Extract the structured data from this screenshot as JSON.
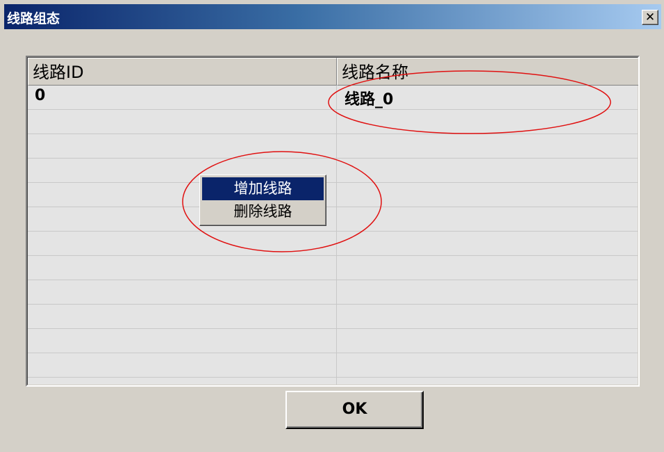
{
  "window": {
    "title": "线路组态",
    "close_icon": "✕"
  },
  "list": {
    "columns": [
      "线路ID",
      "线路名称"
    ],
    "rows": [
      {
        "id": "0",
        "name": "线路_0"
      }
    ]
  },
  "context_menu": {
    "items": [
      "增加线路",
      "删除线路"
    ],
    "selected": 0
  },
  "buttons": {
    "ok": "OK"
  },
  "colors": {
    "selection": "#0a246a",
    "annotation": "#e01010"
  }
}
